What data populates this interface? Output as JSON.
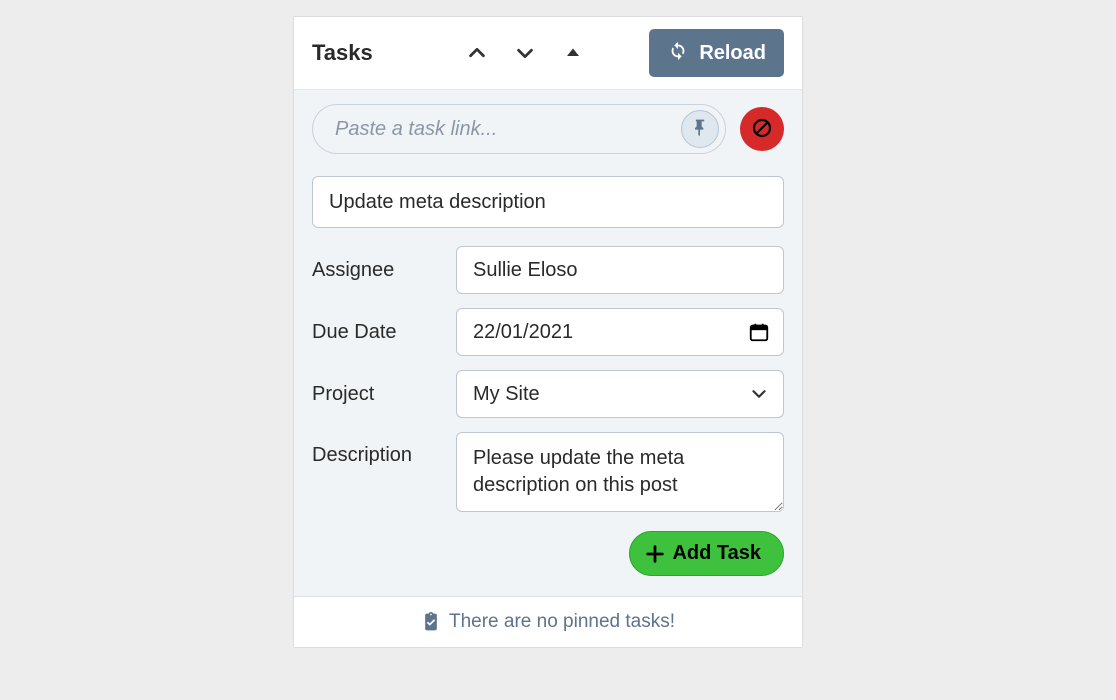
{
  "header": {
    "title": "Tasks",
    "reload_label": "Reload"
  },
  "link_row": {
    "placeholder": "Paste a task link..."
  },
  "form": {
    "title_value": "Update meta description",
    "assignee_label": "Assignee",
    "assignee_value": "Sullie Eloso",
    "due_date_label": "Due Date",
    "due_date_value": "22/01/2021",
    "project_label": "Project",
    "project_value": "My Site",
    "description_label": "Description",
    "description_value": "Please update the meta description on this post",
    "add_task_label": "Add Task"
  },
  "footer": {
    "empty_text": "There are no pinned tasks!"
  }
}
